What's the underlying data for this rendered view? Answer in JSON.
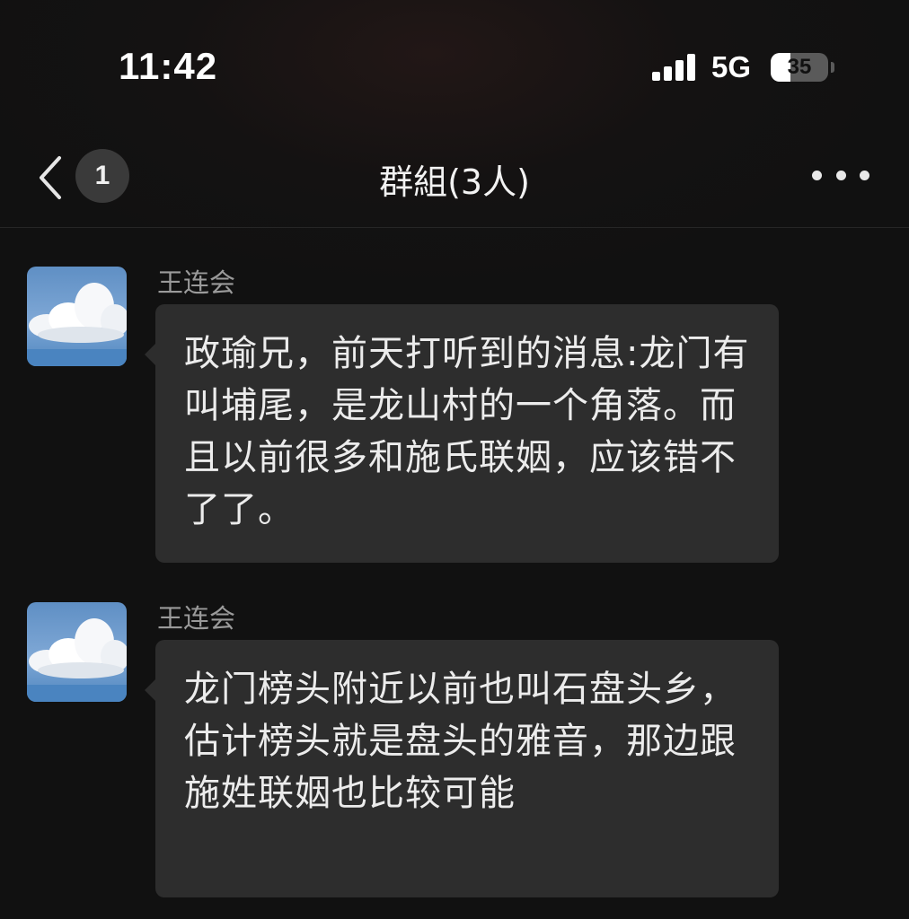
{
  "status_bar": {
    "time": "11:42",
    "network": "5G",
    "battery_level": "35",
    "battery_fraction": 0.35
  },
  "nav": {
    "back_icon": "chevron-left-icon",
    "unread_count": "1",
    "title": "群組(3人)",
    "more_icon": "ellipsis-icon"
  },
  "messages": [
    {
      "sender": "王连会",
      "avatar": "sky-clouds-avatar",
      "text": "政瑜兄，前天打听到的消息:龙门有叫埔尾，是龙山村的一个角落。而且以前很多和施氏联姻，应该错不了了。"
    },
    {
      "sender": "王连会",
      "avatar": "sky-clouds-avatar",
      "text": "龙门榜头附近以前也叫石盘头乡，估计榜头就是盘头的雅音，那边跟施姓联姻也比较可能"
    }
  ],
  "colors": {
    "background": "#111111",
    "bubble": "#2d2d2d",
    "sender_text": "#9a9a9a",
    "message_text": "#ececec"
  }
}
